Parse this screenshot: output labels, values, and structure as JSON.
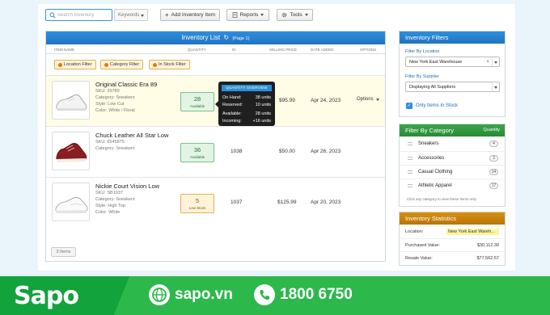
{
  "toolbar": {
    "search_placeholder": "Search Inventory",
    "keywords_label": "Keywords",
    "add_label": "Add Inventory Item",
    "reports_label": "Reports",
    "tools_label": "Tools"
  },
  "main": {
    "title": "Inventory List",
    "subtitle": "(Page 1)",
    "columns": [
      "Item Name",
      "Quantity",
      "ID",
      "Selling Price",
      "Date Added",
      "Options"
    ],
    "filters": [
      "Location Filter",
      "Category Filter",
      "In Stock Filter"
    ],
    "items": [
      {
        "name": "Original Classic Era 89",
        "sku": "SKU: 29789",
        "category": "Category: Sneakers",
        "style": "Style: Low Cut",
        "color": "Color: White / Floral",
        "qty": "28",
        "qty_label": "Available",
        "id": "",
        "price": "$95.99",
        "date": "Apr 24, 2023",
        "options": "Options"
      },
      {
        "name": "Chuck Leather All Star Low",
        "sku": "SKU: 6545875",
        "category": "Category: Sneakers",
        "qty": "36",
        "qty_label": "Available",
        "id": "1038",
        "price": "$50.00",
        "date": "Apr 26, 2023"
      },
      {
        "name": "Nickie Court Vision Low",
        "sku": "SKU: SB1037",
        "category": "Category: Sneakers",
        "style": "Style: High Top",
        "color": "Color: White",
        "qty": "5",
        "qty_label": "Low Stock",
        "id": "1037",
        "price": "$125.99",
        "date": "Apr 20, 2023"
      }
    ],
    "count_label": "3 Items"
  },
  "tooltip": {
    "title": "Quantity Overview",
    "rows": [
      {
        "k": "On Hand:",
        "v": "38 units"
      },
      {
        "k": "Reserved:",
        "v": "10 units"
      },
      {
        "k": "Available:",
        "v": "28 units"
      },
      {
        "k": "Incoming:",
        "v": "+16 units"
      }
    ]
  },
  "filters_panel": {
    "title": "Inventory Filters",
    "location_label": "Filter By Location",
    "location_value": "New York East Warehouse",
    "supplier_label": "Filter By Supplier",
    "supplier_value": "Displaying All Suppliers",
    "instock_label": "Only Items In Stock"
  },
  "category_panel": {
    "title": "Filter By Category",
    "right_label": "Quantity",
    "items": [
      {
        "name": "Sneakers",
        "count": "4"
      },
      {
        "name": "Accessories",
        "count": "3"
      },
      {
        "name": "Casual Clothing",
        "count": "14"
      },
      {
        "name": "Athletic Apparel",
        "count": "17"
      }
    ],
    "hint": "Click any category to view these items only."
  },
  "stats_panel": {
    "title": "Inventory Statistics",
    "rows": [
      {
        "k": "Location:",
        "v": "New York East Wareh..."
      },
      {
        "k": "Purchased Value:",
        "v": "$30,112.30"
      },
      {
        "k": "Resale Value:",
        "v": "$77,562.57"
      }
    ]
  },
  "banner": {
    "logo": "Sapo",
    "website": "sapo.vn",
    "phone": "1800 6750"
  },
  "colors": {
    "accent_blue": "#1f74c2",
    "category_green": "#2b8a38",
    "stats_orange": "#b87409",
    "banner_green": "#2db84c"
  }
}
